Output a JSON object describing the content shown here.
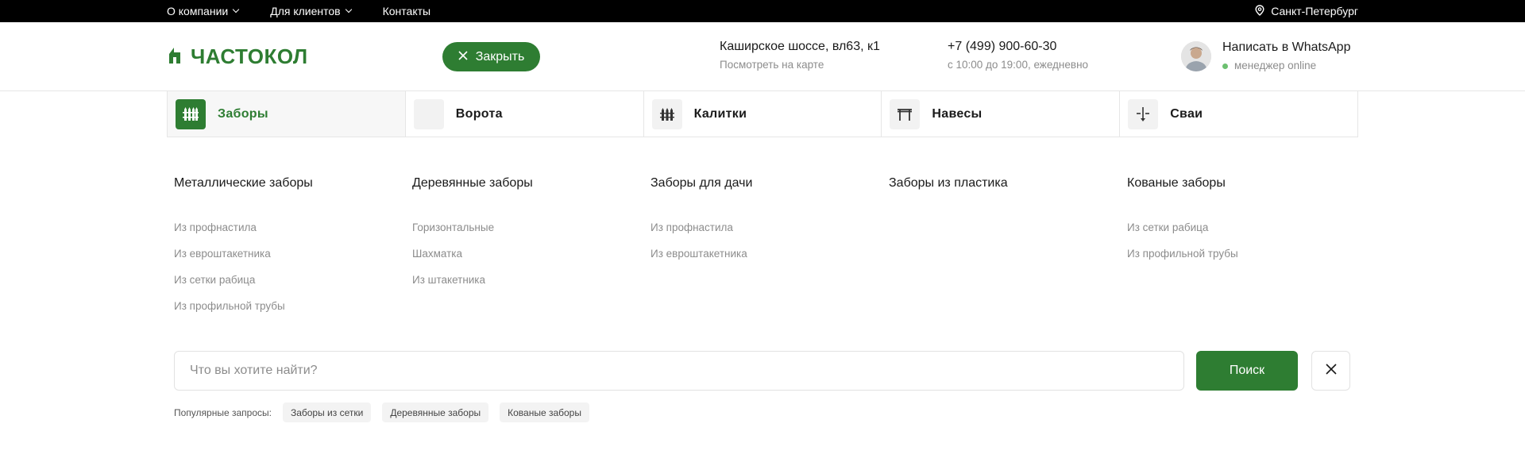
{
  "topbar": {
    "nav": [
      {
        "label": "О компании",
        "dropdown": true
      },
      {
        "label": "Для клиентов",
        "dropdown": true
      },
      {
        "label": "Контакты",
        "dropdown": false
      }
    ],
    "city": "Санкт-Петербург",
    "city_icon": "location-pin-icon"
  },
  "header": {
    "logo_text": "ЧАСТОКОЛ",
    "close_label": "Закрыть",
    "address": {
      "main": "Каширское шоссе, вл63, к1",
      "sub": "Посмотреть на карте"
    },
    "phone": {
      "main": "+7 (499) 900-60-30",
      "sub": "с 10:00 до 19:00, ежедневно"
    },
    "whatsapp": {
      "main": "Написать в WhatsApp",
      "sub": "менеджер online"
    }
  },
  "categories": [
    {
      "label": "Заборы",
      "active": true,
      "icon": "fence-icon"
    },
    {
      "label": "Ворота",
      "active": false,
      "icon": "gate-icon"
    },
    {
      "label": "Калитки",
      "active": false,
      "icon": "wicket-icon"
    },
    {
      "label": "Навесы",
      "active": false,
      "icon": "canopy-icon"
    },
    {
      "label": "Сваи",
      "active": false,
      "icon": "pile-icon"
    }
  ],
  "menu": {
    "columns": [
      {
        "title": "Металлические заборы",
        "links": [
          "Из профнастила",
          "Из евроштакетника",
          "Из сетки рабица",
          "Из профильной трубы"
        ]
      },
      {
        "title": "Деревянные заборы",
        "links": [
          "Горизонтальные",
          "Шахматка",
          "Из штакетника"
        ]
      },
      {
        "title": "Заборы для дачи",
        "links": [
          "Из профнастила",
          "Из евроштакетника"
        ]
      },
      {
        "title": "Заборы из пластика",
        "links": []
      },
      {
        "title": "Кованые заборы",
        "links": [
          "Из сетки рабица",
          "Из профильной трубы"
        ]
      }
    ]
  },
  "search": {
    "placeholder": "Что вы хотите найти?",
    "value": "",
    "button_label": "Поиск",
    "popular_label": "Популярные запросы:",
    "popular": [
      "Заборы из сетки",
      "Деревянные заборы",
      "Кованые заборы"
    ]
  },
  "colors": {
    "brand": "#2e7d32",
    "online": "#6cc070"
  }
}
